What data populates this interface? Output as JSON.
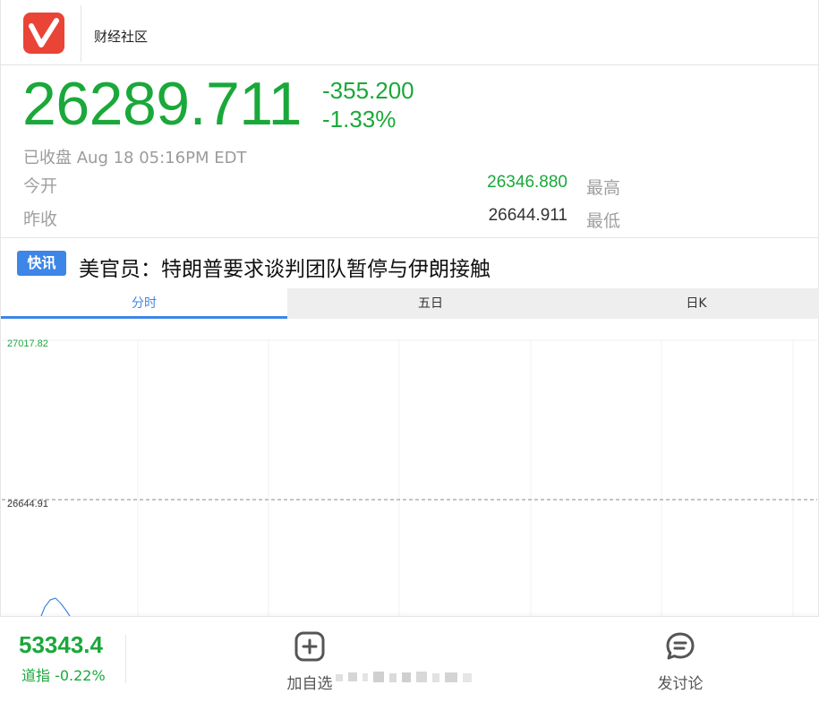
{
  "header": {
    "site_name": "财经社区",
    "logo_icon": "check-logo-icon"
  },
  "quote": {
    "price": "26289.711",
    "change": "-355.200",
    "change_pct": "-1.33%",
    "status": "已收盘 Aug 18 05:16PM EDT",
    "open_label": "今开",
    "open_value": "26346.880",
    "high_label": "最高",
    "prev_close_label": "昨收",
    "prev_close_value": "26644.911",
    "low_label": "最低"
  },
  "news": {
    "badge": "快讯",
    "title": "美官员：特朗普要求谈判团队暂停与伊朗接触"
  },
  "tabs": [
    {
      "label": "分时",
      "active": true
    },
    {
      "label": "五日",
      "active": false
    },
    {
      "label": "日K",
      "active": false
    }
  ],
  "chart": {
    "y_top_label": "27017.82",
    "y_mid_label": "26644.91"
  },
  "bottom": {
    "index_value": "53343.4",
    "index_name": "道指 -0.22%",
    "add_label": "加自选",
    "discuss_label": "发讨论"
  },
  "colors": {
    "down": "#1aa83a",
    "accent": "#3d86e8",
    "logo": "#e94436"
  }
}
